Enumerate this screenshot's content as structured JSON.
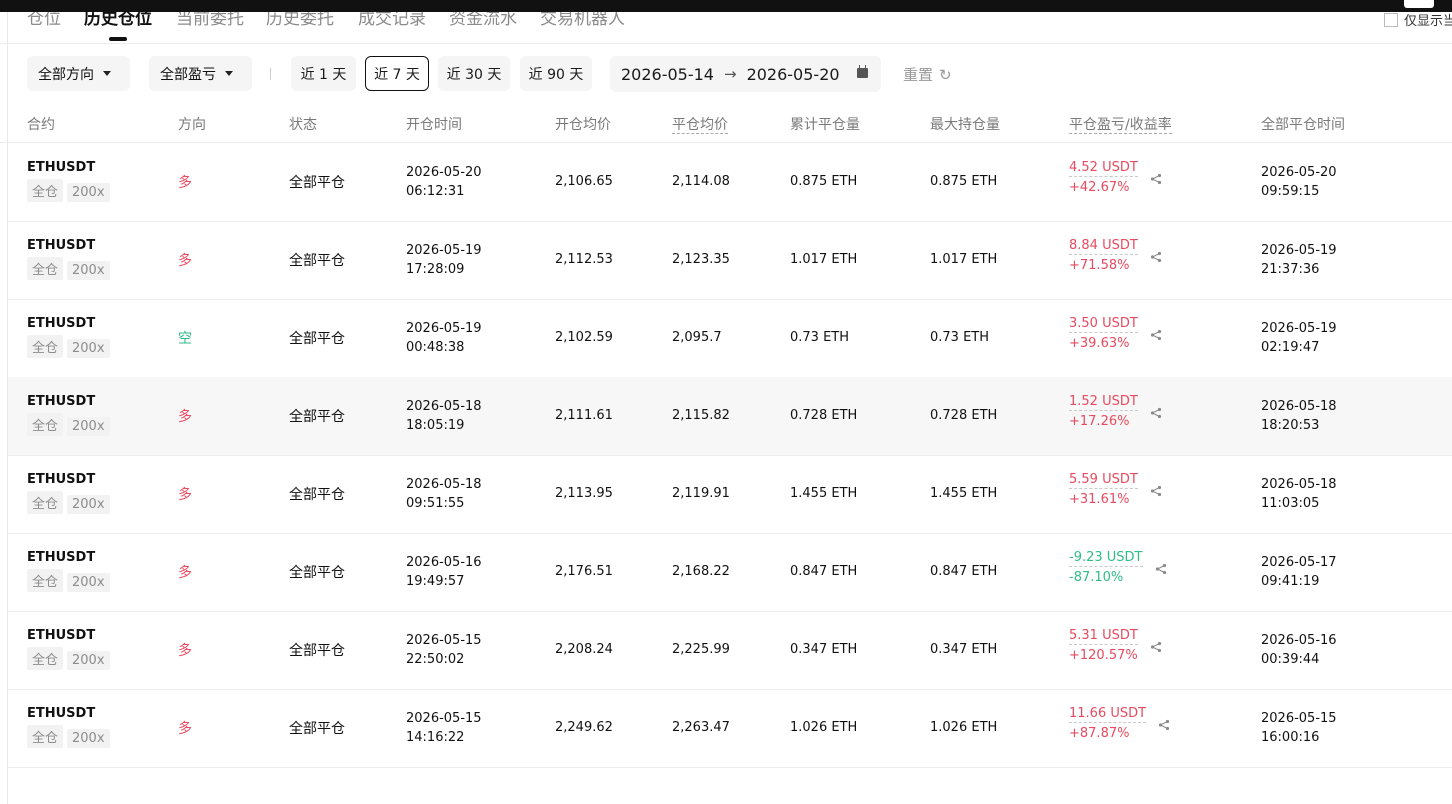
{
  "tabs": [
    {
      "label": "仓位",
      "active": false
    },
    {
      "label": "历史仓位",
      "active": true
    },
    {
      "label": "当前委托",
      "active": false
    },
    {
      "label": "历史委托",
      "active": false
    },
    {
      "label": "成交记录",
      "active": false
    },
    {
      "label": "资金流水",
      "active": false
    },
    {
      "label": "交易机器人",
      "active": false
    }
  ],
  "only_show_label": "仅显示当",
  "filters": {
    "direction": "全部方向",
    "pnl": "全部盈亏",
    "ranges": [
      "近 1 天",
      "近 7 天",
      "近 30 天",
      "近 90 天"
    ],
    "active_range": "近 7 天",
    "date_from": "2026-05-14",
    "date_to": "2026-05-20",
    "reset": "重置"
  },
  "columns": [
    "合约",
    "方向",
    "状态",
    "开仓时间",
    "开仓均价",
    "平仓均价",
    "累计平仓量",
    "最大持仓量",
    "平仓盈亏/收益率",
    "全部平仓时间"
  ],
  "colors": {
    "profit": "#e84a5f",
    "loss": "#2ebd85"
  },
  "rows": [
    {
      "symbol": "ETHUSDT",
      "margin": "全仓",
      "leverage": "200x",
      "direction": "多",
      "dir_type": "long",
      "status": "全部平仓",
      "open_date": "2026-05-20",
      "open_time": "06:12:31",
      "open_price": "2,106.65",
      "close_price": "2,114.08",
      "closed_qty": "0.875 ETH",
      "max_qty": "0.875 ETH",
      "pnl": "4.52 USDT",
      "pnl_rate": "+42.67%",
      "pnl_type": "up",
      "close_date": "2026-05-20",
      "close_time": "09:59:15",
      "highlight": false
    },
    {
      "symbol": "ETHUSDT",
      "margin": "全仓",
      "leverage": "200x",
      "direction": "多",
      "dir_type": "long",
      "status": "全部平仓",
      "open_date": "2026-05-19",
      "open_time": "17:28:09",
      "open_price": "2,112.53",
      "close_price": "2,123.35",
      "closed_qty": "1.017 ETH",
      "max_qty": "1.017 ETH",
      "pnl": "8.84 USDT",
      "pnl_rate": "+71.58%",
      "pnl_type": "up",
      "close_date": "2026-05-19",
      "close_time": "21:37:36",
      "highlight": false
    },
    {
      "symbol": "ETHUSDT",
      "margin": "全仓",
      "leverage": "200x",
      "direction": "空",
      "dir_type": "short",
      "status": "全部平仓",
      "open_date": "2026-05-19",
      "open_time": "00:48:38",
      "open_price": "2,102.59",
      "close_price": "2,095.7",
      "closed_qty": "0.73 ETH",
      "max_qty": "0.73 ETH",
      "pnl": "3.50 USDT",
      "pnl_rate": "+39.63%",
      "pnl_type": "up",
      "close_date": "2026-05-19",
      "close_time": "02:19:47",
      "highlight": false
    },
    {
      "symbol": "ETHUSDT",
      "margin": "全仓",
      "leverage": "200x",
      "direction": "多",
      "dir_type": "long",
      "status": "全部平仓",
      "open_date": "2026-05-18",
      "open_time": "18:05:19",
      "open_price": "2,111.61",
      "close_price": "2,115.82",
      "closed_qty": "0.728 ETH",
      "max_qty": "0.728 ETH",
      "pnl": "1.52 USDT",
      "pnl_rate": "+17.26%",
      "pnl_type": "up",
      "close_date": "2026-05-18",
      "close_time": "18:20:53",
      "highlight": true
    },
    {
      "symbol": "ETHUSDT",
      "margin": "全仓",
      "leverage": "200x",
      "direction": "多",
      "dir_type": "long",
      "status": "全部平仓",
      "open_date": "2026-05-18",
      "open_time": "09:51:55",
      "open_price": "2,113.95",
      "close_price": "2,119.91",
      "closed_qty": "1.455 ETH",
      "max_qty": "1.455 ETH",
      "pnl": "5.59 USDT",
      "pnl_rate": "+31.61%",
      "pnl_type": "up",
      "close_date": "2026-05-18",
      "close_time": "11:03:05",
      "highlight": false
    },
    {
      "symbol": "ETHUSDT",
      "margin": "全仓",
      "leverage": "200x",
      "direction": "多",
      "dir_type": "long",
      "status": "全部平仓",
      "open_date": "2026-05-16",
      "open_time": "19:49:57",
      "open_price": "2,176.51",
      "close_price": "2,168.22",
      "closed_qty": "0.847 ETH",
      "max_qty": "0.847 ETH",
      "pnl": "-9.23 USDT",
      "pnl_rate": "-87.10%",
      "pnl_type": "down",
      "close_date": "2026-05-17",
      "close_time": "09:41:19",
      "highlight": false
    },
    {
      "symbol": "ETHUSDT",
      "margin": "全仓",
      "leverage": "200x",
      "direction": "多",
      "dir_type": "long",
      "status": "全部平仓",
      "open_date": "2026-05-15",
      "open_time": "22:50:02",
      "open_price": "2,208.24",
      "close_price": "2,225.99",
      "closed_qty": "0.347 ETH",
      "max_qty": "0.347 ETH",
      "pnl": "5.31 USDT",
      "pnl_rate": "+120.57%",
      "pnl_type": "up",
      "close_date": "2026-05-16",
      "close_time": "00:39:44",
      "highlight": false
    },
    {
      "symbol": "ETHUSDT",
      "margin": "全仓",
      "leverage": "200x",
      "direction": "多",
      "dir_type": "long",
      "status": "全部平仓",
      "open_date": "2026-05-15",
      "open_time": "14:16:22",
      "open_price": "2,249.62",
      "close_price": "2,263.47",
      "closed_qty": "1.026 ETH",
      "max_qty": "1.026 ETH",
      "pnl": "11.66 USDT",
      "pnl_rate": "+87.87%",
      "pnl_type": "up",
      "close_date": "2026-05-15",
      "close_time": "16:00:16",
      "highlight": false
    }
  ]
}
